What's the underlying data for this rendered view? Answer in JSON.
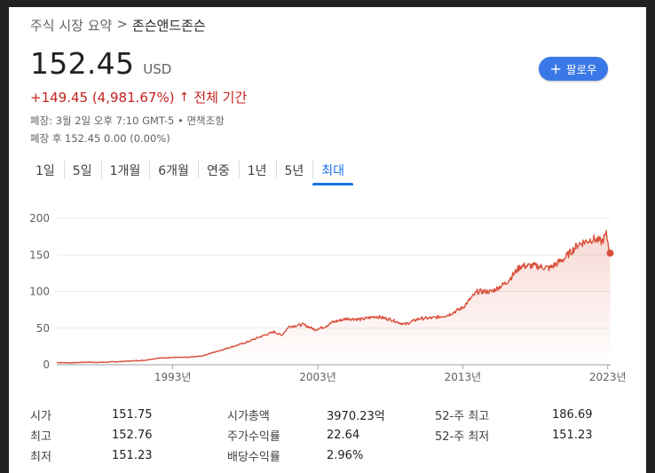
{
  "breadcrumb": {
    "parent": "주식 시장 요약",
    "separator": ">",
    "current": "존슨앤드존슨"
  },
  "quote": {
    "price": "152.45",
    "currency": "USD",
    "change": "+149.45 (4,981.67%)",
    "change_arrow": "↑",
    "period": "전체 기간",
    "close_info": "폐장: 3월 2일 오후 7:10 GMT-5 • 면책조항",
    "after_hours": "폐장 후 152.45 0.00 (0.00%)"
  },
  "follow_button": {
    "icon": "plus-icon",
    "label": "팔로우"
  },
  "tabs": [
    {
      "label": "1일",
      "active": false
    },
    {
      "label": "5일",
      "active": false
    },
    {
      "label": "1개월",
      "active": false
    },
    {
      "label": "6개월",
      "active": false
    },
    {
      "label": "연중",
      "active": false
    },
    {
      "label": "1년",
      "active": false
    },
    {
      "label": "5년",
      "active": false
    },
    {
      "label": "최대",
      "active": true
    }
  ],
  "colors": {
    "line": "#d9503b",
    "accent": "#1a73e8",
    "negative": "#c5221f",
    "button": "#3b78e7"
  },
  "chart_data": {
    "type": "area",
    "ylim": [
      0,
      200
    ],
    "y_ticks": [
      0,
      50,
      100,
      150,
      200
    ],
    "x_range": [
      1985,
      2023.2
    ],
    "x_ticks": [
      {
        "year": 1993,
        "label": "1993년"
      },
      {
        "year": 2003,
        "label": "2003년"
      },
      {
        "year": 2013,
        "label": "2013년"
      },
      {
        "year": 2023,
        "label": "2023년"
      }
    ],
    "grid": true,
    "series": [
      {
        "points": [
          [
            1985,
            3
          ],
          [
            1986,
            2.6
          ],
          [
            1987,
            3.5
          ],
          [
            1988,
            3.2
          ],
          [
            1989,
            4
          ],
          [
            1990,
            5
          ],
          [
            1991,
            6
          ],
          [
            1992,
            9
          ],
          [
            1993,
            10
          ],
          [
            1994,
            10
          ],
          [
            1995,
            12
          ],
          [
            1996,
            18
          ],
          [
            1997,
            24
          ],
          [
            1998,
            30
          ],
          [
            1999,
            38
          ],
          [
            2000,
            45
          ],
          [
            2000.5,
            40
          ],
          [
            2001,
            52
          ],
          [
            2002,
            55
          ],
          [
            2002.8,
            48
          ],
          [
            2003.5,
            52
          ],
          [
            2004,
            58
          ],
          [
            2005,
            63
          ],
          [
            2006,
            62
          ],
          [
            2007,
            66
          ],
          [
            2008,
            62
          ],
          [
            2009,
            55
          ],
          [
            2010,
            63
          ],
          [
            2011,
            64
          ],
          [
            2012,
            68
          ],
          [
            2013,
            78
          ],
          [
            2014,
            100
          ],
          [
            2015,
            100
          ],
          [
            2016,
            112
          ],
          [
            2017,
            135
          ],
          [
            2018,
            135
          ],
          [
            2019,
            132
          ],
          [
            2020,
            145
          ],
          [
            2021,
            165
          ],
          [
            2022,
            172
          ],
          [
            2022.6,
            168
          ],
          [
            2022.9,
            178
          ],
          [
            2023.17,
            152.45
          ]
        ]
      }
    ],
    "last_value": 152.45
  },
  "stats": [
    [
      {
        "label": "시가",
        "value": "151.75"
      },
      {
        "label": "시가총액",
        "value": "3970.23억"
      },
      {
        "label": "52-주 최고",
        "value": "186.69"
      }
    ],
    [
      {
        "label": "최고",
        "value": "152.76"
      },
      {
        "label": "주가수익률",
        "value": "22.64"
      },
      {
        "label": "52-주 최저",
        "value": "151.23"
      }
    ],
    [
      {
        "label": "최저",
        "value": "151.23"
      },
      {
        "label": "배당수익률",
        "value": "2.96%"
      },
      {
        "label": "",
        "value": ""
      }
    ]
  ]
}
